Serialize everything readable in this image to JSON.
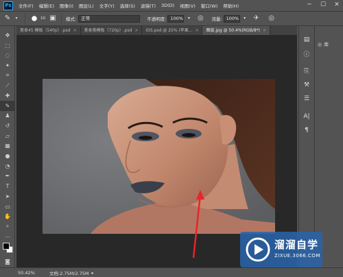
{
  "app": {
    "logo": "Ps"
  },
  "menu": [
    "文件(F)",
    "编辑(E)",
    "图像(I)",
    "图层(L)",
    "文字(Y)",
    "选择(S)",
    "滤镜(T)",
    "3D(D)",
    "视图(V)",
    "窗口(W)",
    "帮助(H)"
  ],
  "window_controls": {
    "minimize": "─",
    "maximize": "☐",
    "close": "✕"
  },
  "options": {
    "brush_size": "10",
    "mode_label": "模式:",
    "mode_value": "正常",
    "opacity_label": "不透明度:",
    "opacity_value": "100%",
    "flow_label": "流量:",
    "flow_value": "100%"
  },
  "tabs": [
    {
      "label": "美食45 模板（540p）.psd",
      "active": false
    },
    {
      "label": "美食美模板（720p）.psd",
      "active": false
    },
    {
      "label": "iOS.psd @ 25% (苹果...",
      "active": false
    },
    {
      "label": "图层.jpg @ 50.4%(RGB/8*)",
      "active": true
    }
  ],
  "tools": [
    "move-icon",
    "marquee-icon",
    "lasso-icon",
    "magic-wand-icon",
    "crop-icon",
    "eyedropper-icon",
    "healing-brush-icon",
    "brush-icon",
    "clone-stamp-icon",
    "history-brush-icon",
    "eraser-icon",
    "gradient-icon",
    "blur-icon",
    "dodge-icon",
    "pen-icon",
    "type-icon",
    "path-select-icon",
    "shape-icon",
    "hand-icon",
    "zoom-icon",
    "more-tools-icon"
  ],
  "right_panel": {
    "library_label": "库"
  },
  "status": {
    "zoom": "50.42%",
    "doc": "文档:2.75M/2.75M"
  },
  "watermark": {
    "title": "溜溜自学",
    "subtitle": "ZIXUE.3066.COM"
  },
  "colors": {
    "arrow": "#e8252a",
    "watermark_bg": "#2864aa"
  }
}
